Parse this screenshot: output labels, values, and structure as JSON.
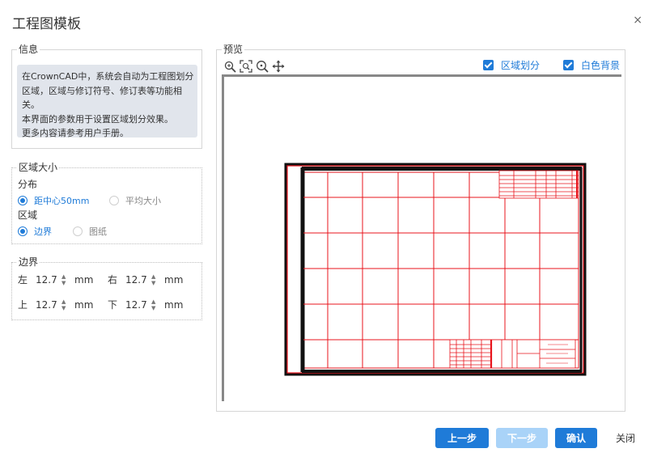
{
  "dialog": {
    "title": "工程图模板",
    "close": "×"
  },
  "info": {
    "legend": "信息",
    "lines": [
      "在CrownCAD中，系统会自动为工程图划分",
      "区域，区域与修订符号、修订表等功能相",
      "关。",
      "本界面的参数用于设置区域划分效果。",
      "更多内容请参考用户手册。"
    ]
  },
  "zone_size": {
    "legend": "区域大小",
    "distribution_label": "分布",
    "distribution_options": [
      {
        "label": "距中心50mm",
        "selected": true
      },
      {
        "label": "平均大小",
        "selected": false
      }
    ],
    "zone_label": "区域",
    "zone_options": [
      {
        "label": "边界",
        "selected": true
      },
      {
        "label": "图纸",
        "selected": false
      }
    ]
  },
  "margins": {
    "legend": "边界",
    "unit": "mm",
    "left": {
      "label": "左",
      "value": "12.7"
    },
    "right": {
      "label": "右",
      "value": "12.7"
    },
    "top": {
      "label": "上",
      "value": "12.7"
    },
    "bottom": {
      "label": "下",
      "value": "12.7"
    }
  },
  "preview": {
    "legend": "预览",
    "tools": [
      "zoom-in-icon",
      "fit-view-icon",
      "zoom-area-icon",
      "pan-icon"
    ],
    "zone_division": {
      "label": "区域划分",
      "checked": true
    },
    "white_background": {
      "label": "白色背景",
      "checked": true
    }
  },
  "footer": {
    "prev": "上一步",
    "next": "下一步",
    "confirm": "确认",
    "close": "关闭"
  },
  "colors": {
    "accent": "#1f7bd8",
    "disabled": "#a9d3f8",
    "zone_lines": "#e8141c",
    "info_bg": "#e1e5ec"
  }
}
